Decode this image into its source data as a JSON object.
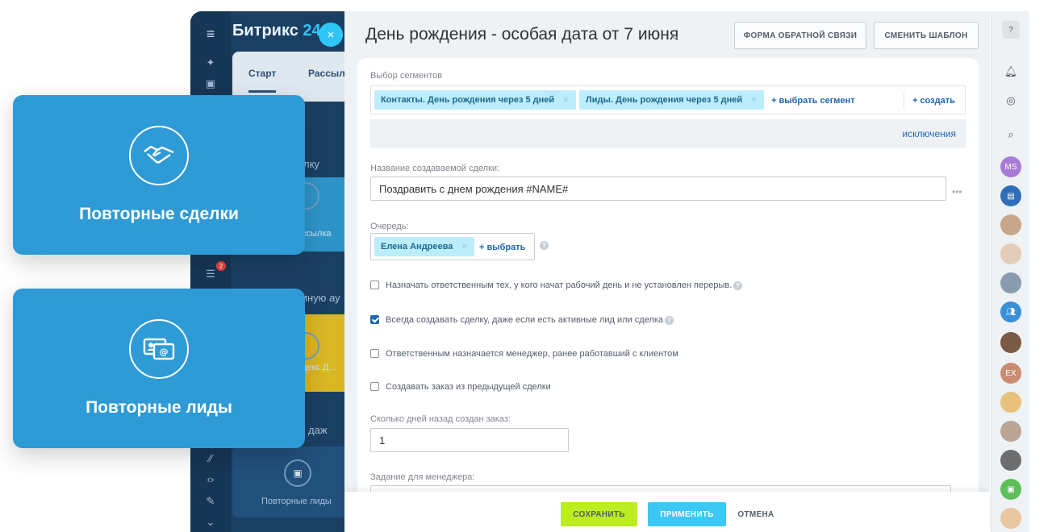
{
  "shell": {
    "brand_name": "Битрикс",
    "brand_num": "24",
    "close_glyph": "×",
    "tab_start": "Старт",
    "tab_mail": "Рассыл",
    "frag_lku": "лку",
    "frag_ssylka": "ссылка",
    "frag_auditory": "мную ау",
    "frag_yandex": "декс.Д...",
    "frag_prodazh": "даж",
    "tile_label_leads": "Повторные лиды",
    "badge_count": "2"
  },
  "cards": [
    {
      "title": "Повторные сделки",
      "icon": "handshake-icon"
    },
    {
      "title": "Повторные лиды",
      "icon": "contact-card-icon"
    }
  ],
  "panel": {
    "title": "День рождения - особая дата от 7 июня",
    "feedback_btn": "ФОРМА ОБРАТНОЙ СВЯЗИ",
    "change_template_btn": "СМЕНИТЬ ШАБЛОН"
  },
  "form": {
    "segments_label": "Выбор сегментов",
    "segment_chips": [
      "Контакты. День рождения через 5 дней",
      "Лиды. День рождения через 5 дней"
    ],
    "select_segment": "+ выбрать сегмент",
    "create": "+ создать",
    "exclusions": "исключения",
    "deal_name_label": "Название создаваемой сделки:",
    "deal_name_value": "Поздравить с днем рождения #NAME#",
    "queue_label": "Очередь:",
    "queue_chip": "Елена Андреева",
    "queue_select": "+ выбрать",
    "checkboxes": [
      {
        "label": "Назначать ответственным тех, у кого начат рабочий день и не установлен перерыв.",
        "checked": false
      },
      {
        "label": "Всегда создавать сделку, даже если есть активные лид или сделка",
        "checked": true
      },
      {
        "label": "Ответственным назначается менеджер, ранее работавший с клиентом",
        "checked": false
      },
      {
        "label": "Создавать заказ из предыдущей сделки",
        "checked": false
      }
    ],
    "days_label": "Сколько дней назад создан заказ:",
    "days_value": "1",
    "task_label": "Задание для менеджера:"
  },
  "actions": {
    "save": "СОХРАНИТЬ",
    "apply": "ПРИМЕНИТЬ",
    "cancel": "ОТМЕНА"
  },
  "rail": {
    "avatar_ms": "MS",
    "avatar_ex": "EX"
  },
  "colors": {
    "card_blue": "#2e9ad6",
    "save_green": "#bbed21",
    "apply_blue": "#3bc8f5",
    "link_blue": "#2066b0",
    "chip_bg": "#bcedfc"
  }
}
